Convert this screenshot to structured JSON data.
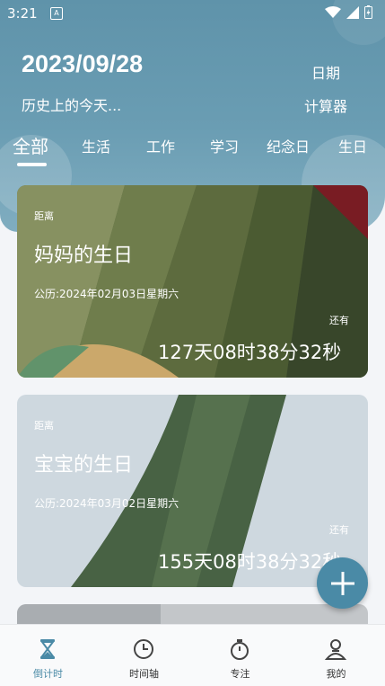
{
  "status_bar": {
    "time": "3:21",
    "notification_icon": "A"
  },
  "header": {
    "date": "2023/09/28",
    "history_label": "历史上的今天...",
    "date_button": "日期",
    "calculator_button": "计算器"
  },
  "tabs": [
    {
      "label": "全部",
      "active": true
    },
    {
      "label": "生活"
    },
    {
      "label": "工作"
    },
    {
      "label": "学习"
    },
    {
      "label": "纪念日"
    },
    {
      "label": "生日"
    }
  ],
  "cards": [
    {
      "distance_label": "距离",
      "title": "妈妈的生日",
      "solar_date": "公历:2024年02月03日星期六",
      "remaining_label": "还有",
      "countdown": "127天08时38分32秒"
    },
    {
      "distance_label": "距离",
      "title": "宝宝的生日",
      "solar_date": "公历:2024年03月02日星期六",
      "remaining_label": "还有",
      "countdown": "155天08时38分32秒"
    }
  ],
  "bottom_nav": [
    {
      "label": "倒计时",
      "icon": "hourglass-icon",
      "active": true
    },
    {
      "label": "时间轴",
      "icon": "clock-icon"
    },
    {
      "label": "专注",
      "icon": "stopwatch-icon"
    },
    {
      "label": "我的",
      "icon": "person-icon"
    }
  ],
  "colors": {
    "accent": "#4a8aa6",
    "header": "#6a9db3"
  }
}
